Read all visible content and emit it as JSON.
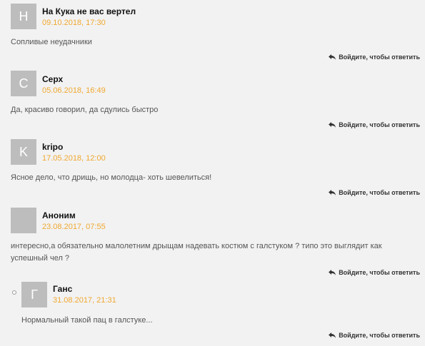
{
  "comments": [
    {
      "avatar_letter": "Н",
      "author": "На Кука не вас вертел",
      "date": "09.10.2018, 17:30",
      "text": "Сопливые неудачники",
      "reply_label": "Войдите, чтобы ответить"
    },
    {
      "avatar_letter": "С",
      "author": "Серх",
      "date": "05.06.2018, 16:49",
      "text": "Да, красиво говорил, да сдулись быстро",
      "reply_label": "Войдите, чтобы ответить"
    },
    {
      "avatar_letter": "K",
      "author": "kripo",
      "date": "17.05.2018, 12:00",
      "text": "Ясное дело, что дрищь, но молодца- хоть шевелиться!",
      "reply_label": "Войдите, чтобы ответить"
    },
    {
      "avatar_letter": "",
      "author": "Аноним",
      "date": "23.08.2017, 07:55",
      "text": "интересно,а обязательно малолетним дрыщам надевать костюм с галстуком ? типо это выглядит как успешный чел ?",
      "reply_label": "Войдите, чтобы ответить"
    },
    {
      "avatar_letter": "Г",
      "author": "Ганс",
      "date": "31.08.2017, 21:31",
      "text": "Нормальный такой пац в галстуке...",
      "reply_label": "Войдите, чтобы ответить"
    }
  ],
  "colors": {
    "date": "#f0a830",
    "avatar_bg": "#bdbdbd",
    "background": "#f2f2f2"
  },
  "icons": {
    "reply": "reply-arrow-icon",
    "nested_marker": "bullet-icon"
  }
}
